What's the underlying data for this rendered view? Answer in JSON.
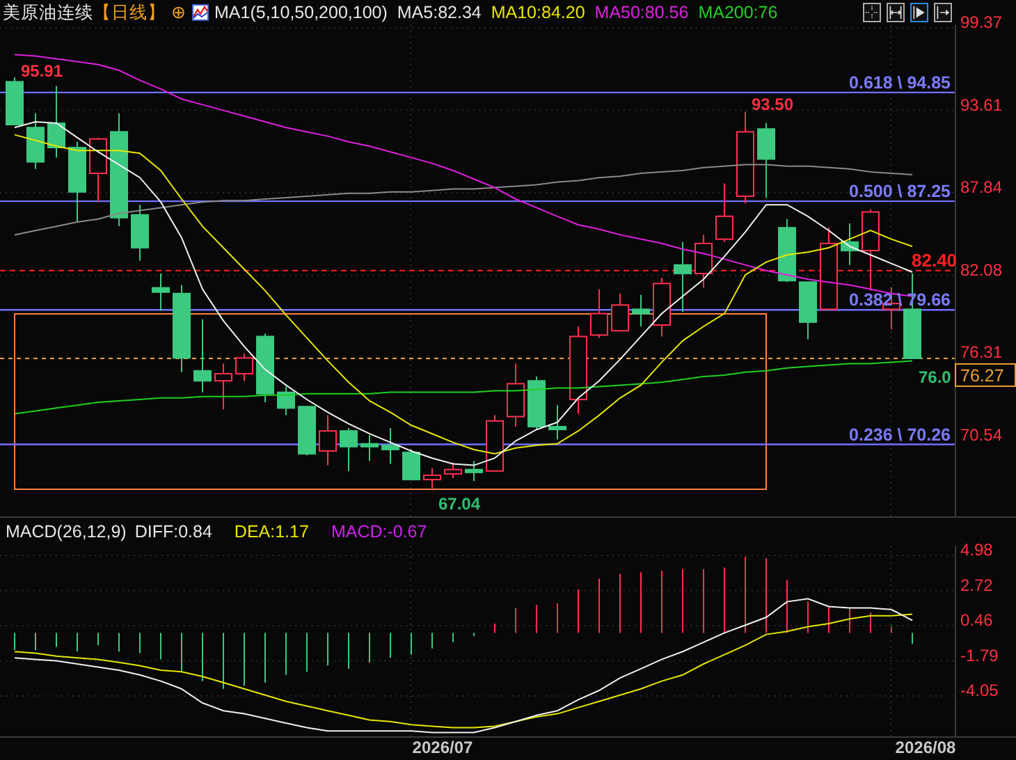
{
  "header": {
    "title": "美原油连续",
    "period": "【日线】",
    "add_symbol": "⊕",
    "indicator": "MA1(5,10,50,200,100)",
    "values": [
      {
        "label": "MA5:82.34",
        "color": "#e6e6e6"
      },
      {
        "label": "MA10:84.20",
        "color": "#e6e600"
      },
      {
        "label": "MA50:80.56",
        "color": "#e020e0"
      },
      {
        "label": "MA200:76",
        "color": "#20d020"
      }
    ]
  },
  "toolbar": [
    {
      "kind": "crosshair",
      "selected": false
    },
    {
      "kind": "range",
      "selected": false
    },
    {
      "kind": "play",
      "selected": true
    },
    {
      "kind": "shift",
      "selected": false
    }
  ],
  "price_panel": {
    "chart_data": {
      "type": "candlestick",
      "grid": true,
      "ylim": [
        65.13,
        99.56
      ],
      "yticks": [
        {
          "value": 99.37,
          "label": "99.37"
        },
        {
          "value": 93.61,
          "label": "93.61"
        },
        {
          "value": 87.84,
          "label": "87.84"
        },
        {
          "value": 82.08,
          "label": "82.08"
        },
        {
          "value": 76.31,
          "label": "76.31"
        },
        {
          "value": 70.54,
          "label": "70.54"
        }
      ],
      "ohlc": [
        [
          95.6,
          95.91,
          92.6,
          92.6
        ],
        [
          92.4,
          93.4,
          89.5,
          90.0
        ],
        [
          92.7,
          95.3,
          90.3,
          91.0
        ],
        [
          91.0,
          91.4,
          85.8,
          87.9
        ],
        [
          89.2,
          91.7,
          87.2,
          91.6
        ],
        [
          92.1,
          93.4,
          85.5,
          86.1
        ],
        [
          86.3,
          87.0,
          83.1,
          84.0
        ],
        [
          81.2,
          82.2,
          79.6,
          80.9
        ],
        [
          80.8,
          81.4,
          75.3,
          76.3
        ],
        [
          75.4,
          79.0,
          73.9,
          74.7
        ],
        [
          74.7,
          75.9,
          72.7,
          75.2
        ],
        [
          75.2,
          76.6,
          74.7,
          76.3
        ],
        [
          77.8,
          78.0,
          73.2,
          73.8
        ],
        [
          73.9,
          74.3,
          72.3,
          72.8
        ],
        [
          72.9,
          72.9,
          69.5,
          69.6
        ],
        [
          69.8,
          72.3,
          68.8,
          71.2
        ],
        [
          71.2,
          71.4,
          68.4,
          70.1
        ],
        [
          70.3,
          70.9,
          69.1,
          70.1
        ],
        [
          70.2,
          71.4,
          68.9,
          69.9
        ],
        [
          69.7,
          69.9,
          67.8,
          67.8
        ],
        [
          67.8,
          68.6,
          67.04,
          68.1
        ],
        [
          68.2,
          69.0,
          67.9,
          68.5
        ],
        [
          68.5,
          69.1,
          67.7,
          68.3
        ],
        [
          68.4,
          72.3,
          68.4,
          71.9
        ],
        [
          72.2,
          75.9,
          71.5,
          74.5
        ],
        [
          74.7,
          75.0,
          71.3,
          71.5
        ],
        [
          71.5,
          73.0,
          70.6,
          71.3
        ],
        [
          73.4,
          78.5,
          72.4,
          77.8
        ],
        [
          77.9,
          81.1,
          77.7,
          79.4
        ],
        [
          78.2,
          80.8,
          78.2,
          80.0
        ],
        [
          79.7,
          80.7,
          78.5,
          79.4
        ],
        [
          78.6,
          81.9,
          77.8,
          81.5
        ],
        [
          82.8,
          84.4,
          79.5,
          82.2
        ],
        [
          82.2,
          84.9,
          81.2,
          84.3
        ],
        [
          84.6,
          88.5,
          84.4,
          86.2
        ],
        [
          87.6,
          93.5,
          87.1,
          92.1
        ],
        [
          92.3,
          92.7,
          87.5,
          90.2
        ],
        [
          85.4,
          86.0,
          81.6,
          81.7
        ],
        [
          81.6,
          81.6,
          77.6,
          78.8
        ],
        [
          79.7,
          85.4,
          79.7,
          84.3
        ],
        [
          84.4,
          85.7,
          82.8,
          83.8
        ],
        [
          83.8,
          86.7,
          81.0,
          86.5
        ],
        [
          79.7,
          81.2,
          78.3,
          80.1
        ],
        [
          79.7,
          82.2,
          76.27,
          76.27
        ]
      ],
      "series": [
        {
          "type": "line",
          "color": "#8a8a8a",
          "values": [
            84.9,
            85.2,
            85.5,
            85.8,
            86.0,
            86.4,
            86.6,
            86.8,
            87.0,
            87.2,
            87.3,
            87.3,
            87.4,
            87.5,
            87.6,
            87.7,
            87.8,
            87.8,
            87.9,
            87.9,
            88.0,
            88.1,
            88.1,
            88.2,
            88.3,
            88.4,
            88.6,
            88.7,
            88.9,
            89.0,
            89.2,
            89.3,
            89.4,
            89.6,
            89.7,
            89.8,
            89.8,
            89.7,
            89.7,
            89.6,
            89.5,
            89.3,
            89.2,
            89.1
          ]
        },
        {
          "type": "line",
          "color": "#20d020",
          "values": [
            72.4,
            72.6,
            72.8,
            73.0,
            73.2,
            73.3,
            73.4,
            73.5,
            73.5,
            73.6,
            73.6,
            73.6,
            73.7,
            73.7,
            73.8,
            73.8,
            73.8,
            73.8,
            73.9,
            73.9,
            73.9,
            73.9,
            73.9,
            74.0,
            74.0,
            74.1,
            74.2,
            74.2,
            74.3,
            74.4,
            74.5,
            74.6,
            74.8,
            75.0,
            75.1,
            75.3,
            75.4,
            75.6,
            75.7,
            75.8,
            75.9,
            75.9,
            76.0,
            76.1
          ]
        },
        {
          "type": "line",
          "color": "#e020e0",
          "values": [
            97.5,
            97.4,
            97.2,
            97.0,
            96.8,
            96.4,
            95.7,
            95.1,
            94.4,
            94.0,
            93.6,
            93.2,
            92.8,
            92.4,
            92.1,
            91.8,
            91.4,
            91.1,
            90.7,
            90.3,
            89.9,
            89.4,
            88.8,
            88.2,
            87.4,
            86.8,
            86.2,
            85.6,
            85.3,
            84.9,
            84.6,
            84.3,
            83.9,
            83.6,
            83.2,
            82.8,
            82.4,
            82.1,
            81.8,
            81.6,
            81.4,
            81.1,
            80.8,
            80.6
          ]
        },
        {
          "type": "line",
          "color": "#e6e600",
          "values": [
            91.9,
            91.5,
            91.1,
            90.8,
            90.8,
            90.8,
            90.6,
            89.4,
            87.4,
            85.5,
            84.0,
            82.5,
            81.0,
            79.3,
            77.7,
            76.1,
            74.6,
            73.3,
            72.5,
            71.6,
            71.0,
            70.4,
            69.9,
            69.6,
            70.0,
            70.2,
            70.3,
            71.2,
            72.3,
            73.5,
            74.4,
            76.0,
            77.5,
            78.5,
            79.4,
            82.1,
            83.0,
            83.5,
            83.7,
            84.0,
            84.6,
            85.2,
            84.6,
            84.1
          ]
        },
        {
          "type": "line",
          "color": "#f0f0f0",
          "values": [
            92.4,
            92.8,
            92.7,
            91.7,
            90.7,
            89.8,
            88.9,
            87.2,
            84.7,
            81.1,
            78.9,
            77.1,
            75.5,
            74.4,
            73.4,
            72.5,
            71.7,
            71.0,
            70.4,
            69.8,
            69.3,
            68.9,
            68.8,
            69.3,
            70.5,
            71.3,
            71.8,
            73.5,
            74.7,
            76.2,
            77.8,
            79.4,
            80.6,
            81.8,
            83.4,
            85.1,
            87.0,
            87.0,
            86.2,
            85.2,
            84.1,
            83.5,
            82.9,
            82.3
          ]
        }
      ],
      "ref_lines": [
        {
          "axis": "y",
          "value": 94.85,
          "label": "0.618 \\ 94.85",
          "color": "#7070ff"
        },
        {
          "axis": "y",
          "value": 87.25,
          "label": "0.500 \\ 87.25",
          "color": "#7070ff"
        },
        {
          "axis": "y",
          "value": 79.66,
          "label": "0.382 \\ 79.66",
          "color": "#7070ff"
        },
        {
          "axis": "y",
          "value": 70.26,
          "label": "0.236 \\ 70.26",
          "color": "#7070ff"
        },
        {
          "axis": "y",
          "value": 82.4,
          "label": "82.40",
          "color": "#ff2020"
        },
        {
          "axis": "y",
          "value": 76.27,
          "label": "76.27",
          "color": "#f0a030"
        }
      ]
    },
    "markers": [
      {
        "text": "95.91",
        "kind": "high"
      },
      {
        "text": "93.50",
        "kind": "high"
      },
      {
        "text": "67.04",
        "kind": "low"
      },
      {
        "text": "76.0",
        "kind": "last"
      }
    ]
  },
  "macd_panel": {
    "legend": [
      {
        "label": "MACD(26,12,9)",
        "color": "#e6e6e6"
      },
      {
        "label": "DIFF:0.84",
        "color": "#e6e6e6"
      },
      {
        "label": "DEA:1.17",
        "color": "#e6e600"
      },
      {
        "label": "MACD:-0.67",
        "color": "#d020f0"
      }
    ],
    "chart_data": {
      "type": "line",
      "grid": true,
      "ylim": [
        -6.74,
        5.61
      ],
      "yticks": [
        {
          "value": 4.98,
          "label": "4.98"
        },
        {
          "value": 2.72,
          "label": "2.72"
        },
        {
          "value": 0.46,
          "label": "0.46"
        },
        {
          "value": -1.79,
          "label": "-1.79"
        },
        {
          "value": -4.05,
          "label": "-4.05"
        }
      ],
      "series": [
        {
          "type": "bar",
          "color": "#3cc980",
          "values": [
            -1.1,
            -1.1,
            -0.9,
            -1.2,
            -0.8,
            -1.2,
            -1.3,
            -1.7,
            -2.5,
            -3.1,
            -3.6,
            -3.4,
            -3.2,
            -2.7,
            -2.5,
            -2.1,
            -2.3,
            -1.9,
            -1.6,
            -1.4,
            -1.0,
            -0.6,
            -0.2,
            null,
            null,
            null,
            null,
            null,
            null,
            null,
            null,
            null,
            null,
            null,
            null,
            null,
            null,
            null,
            null,
            null,
            null,
            null,
            null,
            -0.7
          ]
        },
        {
          "type": "bar",
          "color": "#ff3050",
          "values": [
            null,
            null,
            null,
            null,
            null,
            null,
            null,
            null,
            null,
            null,
            null,
            null,
            null,
            null,
            null,
            null,
            null,
            null,
            null,
            null,
            null,
            null,
            null,
            0.6,
            1.6,
            1.8,
            1.9,
            2.8,
            3.5,
            3.8,
            3.9,
            4.0,
            4.1,
            4.1,
            4.2,
            4.9,
            4.8,
            3.4,
            2.0,
            1.7,
            1.6,
            1.3,
            0.4,
            null
          ]
        },
        {
          "color": "#e6e600",
          "values": [
            -1.2,
            -1.3,
            -1.5,
            -1.6,
            -1.7,
            -1.9,
            -2.1,
            -2.4,
            -2.5,
            -2.8,
            -3.2,
            -3.6,
            -4.0,
            -4.4,
            -4.7,
            -5.0,
            -5.3,
            -5.6,
            -5.7,
            -5.9,
            -6.0,
            -6.1,
            -6.1,
            -6.0,
            -5.7,
            -5.4,
            -5.2,
            -4.8,
            -4.4,
            -4.0,
            -3.6,
            -3.1,
            -2.7,
            -2.0,
            -1.4,
            -0.8,
            -0.1,
            0.1,
            0.4,
            0.6,
            0.9,
            1.1,
            1.1,
            1.2
          ]
        },
        {
          "color": "#f0f0f0",
          "values": [
            -1.6,
            -1.7,
            -1.8,
            -2.0,
            -2.2,
            -2.4,
            -2.7,
            -3.1,
            -3.6,
            -4.5,
            -5.0,
            -5.2,
            -5.5,
            -5.8,
            -6.1,
            -6.3,
            -6.3,
            -6.3,
            -6.3,
            -6.3,
            -6.4,
            -6.4,
            -6.4,
            -6.1,
            -5.7,
            -5.3,
            -5.0,
            -4.3,
            -3.7,
            -2.9,
            -2.3,
            -1.7,
            -1.2,
            -0.6,
            0.0,
            0.5,
            1.0,
            2.0,
            2.2,
            1.7,
            1.6,
            1.6,
            1.5,
            0.8
          ]
        }
      ]
    }
  },
  "time_axis": [
    "2026/07",
    "2026/08"
  ]
}
